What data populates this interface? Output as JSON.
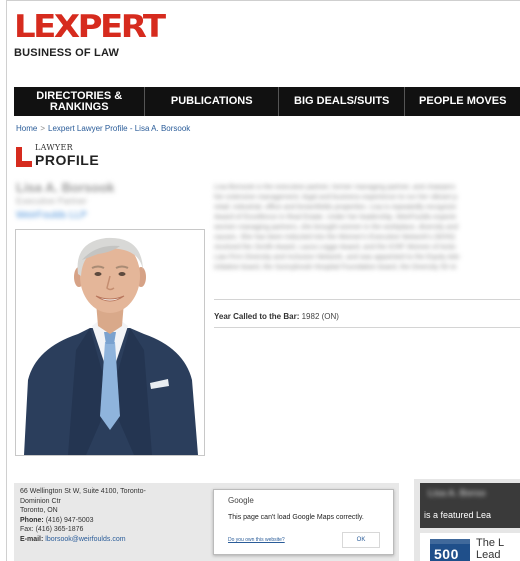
{
  "brand": {
    "logo_text": "LEXPERT",
    "tagline": "BUSINESS OF LAW",
    "accent_color": "#d62b1e"
  },
  "nav": {
    "directories_line1": "DIRECTORIES &",
    "directories_line2": "RANKINGS",
    "publications": "PUBLICATIONS",
    "big_deals": "BIG DEALS/SUITS",
    "people_moves": "PEOPLE MOVES"
  },
  "breadcrumb": {
    "home": "Home",
    "separator": ">",
    "current": "Lexpert Lawyer Profile - Lisa A. Borsook"
  },
  "profile_badge": {
    "line1": "LAWYER",
    "line2": "PROFILE"
  },
  "profile": {
    "name": "Lisa A. Borsook",
    "role": "Executive Partner",
    "firm": "WeirFoulds LLP",
    "bio_lines": [
      "Lisa Borsook is the executive partner, former managing partner, and chairpers",
      "her extensive management, legal and business experience to run her vibrant p",
      "retail, industrial, office and brownfields properties. Lisa is repeatedly recognize",
      "Award of Excellence in Real Estate. Under her leadership, WeirFoulds experie",
      "women managing partners, she brought women in the workplace, diversity and",
      "causes. She has been inducted into the Women's Executive Network's (WXN)",
      "received the Zenith Award, Laura Legge Award, and the ICRF Women of Actio",
      "Law Firm Diversity and Inclusion Network, and was appointed to the Equity Adv",
      "initiative board, the Sunnybrook Hospital Foundation board, the Diversity 50 re"
    ],
    "bar_label": "Year Called to the Bar:",
    "bar_value": "1982 (ON)"
  },
  "contact": {
    "address_line1": "66 Wellington St W, Suite 4100, Toronto-",
    "address_line2": "Dominion Ctr",
    "address_line3": "Toronto, ON",
    "phone_label": "Phone:",
    "phone": "(416) 947-5003",
    "fax_label": "Fax:",
    "fax": "(416) 365-1876",
    "email_label": "E-mail:",
    "email": "lborsook@weirfoulds.com"
  },
  "map_error": {
    "provider": "Google",
    "message": "This page can't load Google Maps correctly.",
    "own_site": "Do you own this website?",
    "ok": "OK"
  },
  "featured": {
    "name": "Lisa A. Borso",
    "text": "is a featured Lea",
    "badge": "500",
    "side_line1": "The L",
    "side_line2": "Lead"
  }
}
